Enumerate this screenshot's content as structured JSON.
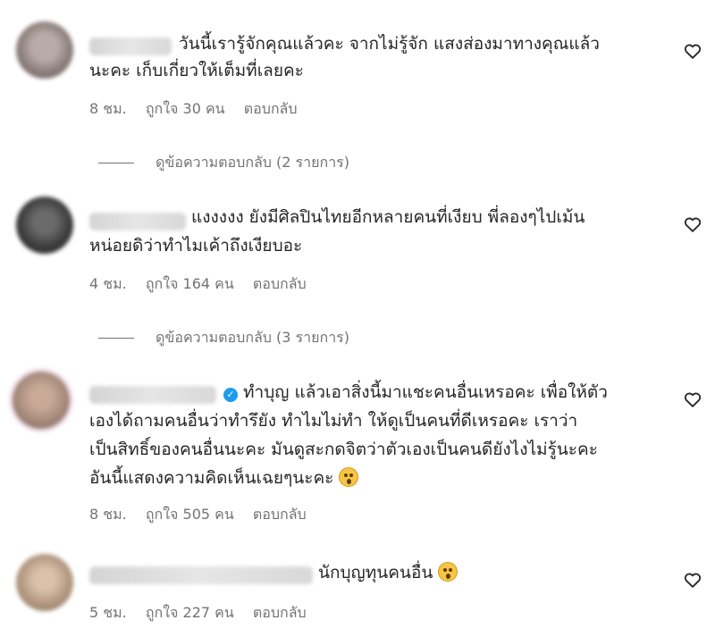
{
  "comments": [
    {
      "text_lines": [
        "วันนี้เรารู้จักคุณแล้วคะ จากไม่รู้จัก แสงส่องมาทางคุณแล้ว",
        "นะคะ เก็บเกี่ยวให้เต็มที่เลยคะ"
      ],
      "time": "8 ชม.",
      "likes": "ถูกใจ 30 คน",
      "reply": "ตอบกลับ",
      "view_replies": "ดูข้อความตอบกลับ (2 รายการ)",
      "avatar_color": "#8a7d7a"
    },
    {
      "text_lines": [
        "แงงงงง ยังมีศิลปินไทยอีกหลายคนที่เงียบ พี่ลองๆไปเม้น",
        "หน่อยดิว่าทำไมเค้าถึงเงียบอะ"
      ],
      "time": "4 ชม.",
      "likes": "ถูกใจ 164 คน",
      "reply": "ตอบกลับ",
      "view_replies": "ดูข้อความตอบกลับ (3 รายการ)",
      "avatar_color": "#3a3a3a"
    },
    {
      "text_lines": [
        "ทำบุญ แล้วเอาสิ่งนี้มาแชะคนอื่นเหรอคะ เพื่อให้ตัว",
        "เองได้ถามคนอื่นว่าทำรึยัง ทำไมไม่ทำ ให้ดูเป็นคนที่ดีเหรอคะ เราว่า",
        "เป็นสิทธิ์ของคนอื่นนะคะ มันดูสะกดจิตว่าตัวเองเป็นคนดียังไงไม่รู้นะคะ",
        "อันนี้แสดงความคิดเห็นเฉยๆนะคะ"
      ],
      "time": "8 ชม.",
      "likes": "ถูกใจ 505 คน",
      "reply": "ตอบกลับ",
      "avatar_color": "#a88c7c"
    },
    {
      "text_lines": [
        "นักบุญทุนคนอื่น"
      ],
      "time": "5 ชม.",
      "likes": "ถูกใจ 227 คน",
      "reply": "ตอบกลับ",
      "avatar_color": "#b59a82"
    }
  ],
  "icons": {
    "like": "heart-outline-icon",
    "verified": "verified-badge-icon",
    "emoji": "astonished-face-emoji"
  },
  "colors": {
    "text": "#262626",
    "meta": "#737373",
    "verified": "#1d9bf0"
  }
}
